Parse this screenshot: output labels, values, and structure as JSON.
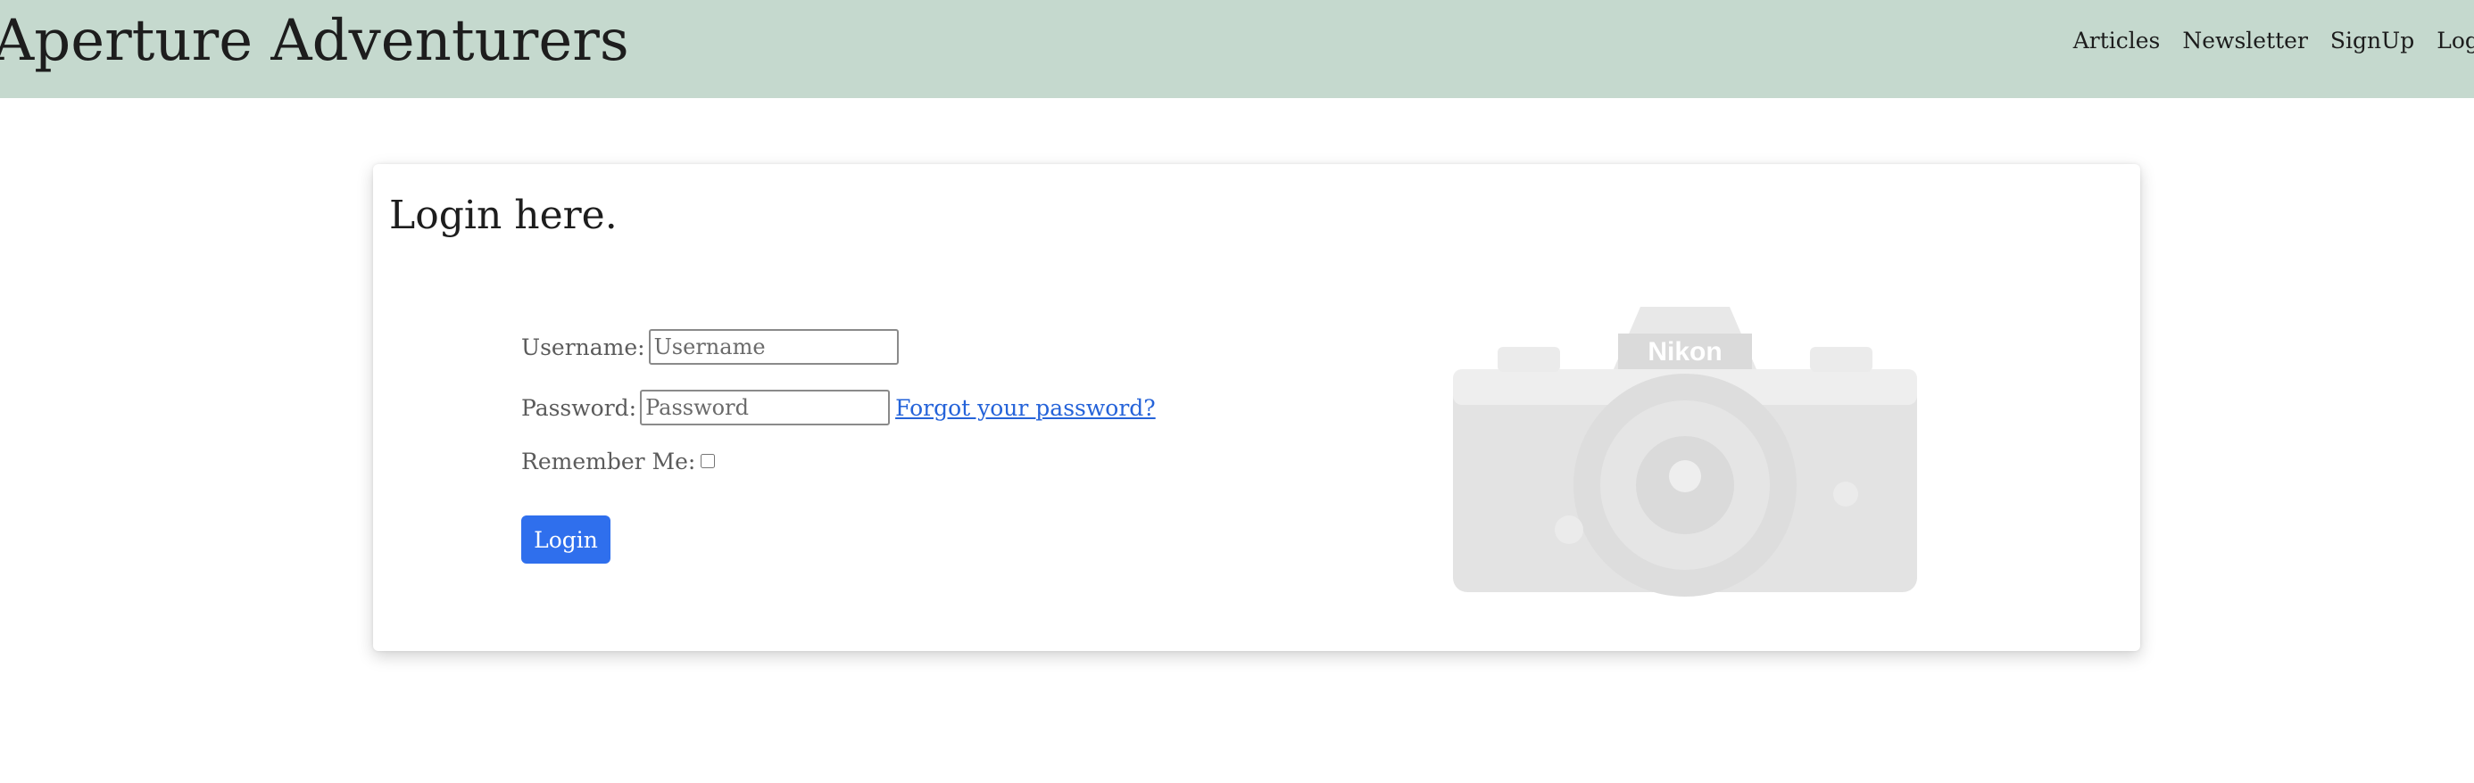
{
  "header": {
    "site_title": "Aperture Adventurers",
    "nav": [
      "Articles",
      "Newsletter",
      "SignUp",
      "Login"
    ],
    "background_color": "#c5d9ce"
  },
  "login_card": {
    "title": "Login here.",
    "username_label": "Username:",
    "username_placeholder": "Username",
    "username_value": "",
    "password_label": "Password:",
    "password_placeholder": "Password",
    "password_value": "",
    "forgot_link": "Forgot your password?",
    "remember_label": "Remember Me:",
    "remember_checked": false,
    "login_button": "Login",
    "button_color": "#2f6fed",
    "link_color": "#2563d9",
    "camera_image": {
      "icon": "camera-icon",
      "brand_text": "Nikon"
    }
  }
}
